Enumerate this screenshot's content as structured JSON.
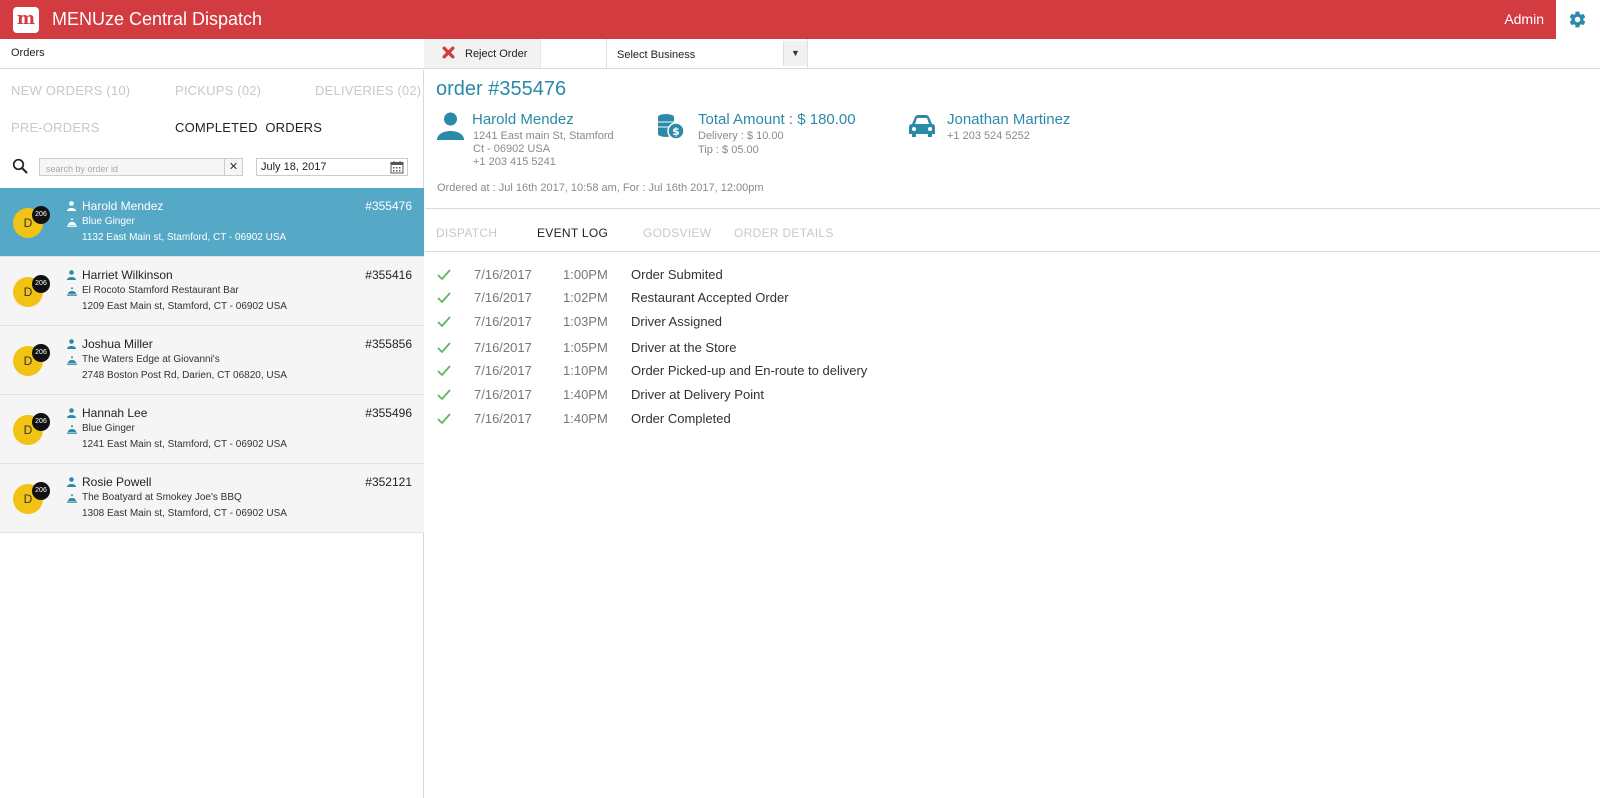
{
  "header": {
    "logo_letter": "m",
    "title": "MENUze Central Dispatch",
    "user": "Admin",
    "settings_icon": "gear-icon"
  },
  "toolbar": {
    "orders_label": "Orders",
    "reject_label": "Reject Order",
    "business_select": "Select Business"
  },
  "filters": {
    "new_orders": "NEW ORDERS (10)",
    "pickups": "PICKUPS (02)",
    "deliveries": "DELIVERIES (02)",
    "pre_orders": "PRE-ORDERS",
    "completed": "COMPLETED",
    "orders": "ORDERS"
  },
  "search": {
    "placeholder": "search by order id",
    "value": "",
    "clear": "✕",
    "date": "July 18, 2017"
  },
  "orders": [
    {
      "initial": "D",
      "badge": "206",
      "customer": "Harold Mendez",
      "restaurant": "Blue Ginger",
      "address": "1132 East Main st, Stamford, CT - 06902 USA",
      "number": "#355476"
    },
    {
      "initial": "D",
      "badge": "206",
      "customer": "Harriet Wilkinson",
      "restaurant": "El Rocoto Stamford Restaurant Bar",
      "address": "1209 East Main st, Stamford, CT - 06902 USA",
      "number": "#355416"
    },
    {
      "initial": "D",
      "badge": "206",
      "customer": "Joshua Miller",
      "restaurant": "The Waters Edge at Giovanni's",
      "address": "2748 Boston Post Rd, Darien, CT 06820, USA",
      "number": "#355856"
    },
    {
      "initial": "D",
      "badge": "206",
      "customer": "Hannah Lee",
      "restaurant": "Blue Ginger",
      "address": "1241 East Main st, Stamford, CT - 06902 USA",
      "number": "#355496"
    },
    {
      "initial": "D",
      "badge": "206",
      "customer": "Rosie Powell",
      "restaurant": "The Boatyard at Smokey Joe's BBQ",
      "address": "1308 East Main st, Stamford, CT - 06902 USA",
      "number": "#352121"
    }
  ],
  "detail": {
    "title": "order #355476",
    "customer": {
      "name": "Harold Mendez",
      "address1": "1241 East main St, Stamford",
      "address2": "Ct - 06902 USA",
      "phone": "+1 203 415 5241"
    },
    "amount": {
      "total": "Total Amount : $ 180.00",
      "delivery": "Delivery : $ 10.00",
      "tip": "Tip : $ 05.00"
    },
    "driver": {
      "name": "Jonathan Martinez",
      "phone": "+1 203 524 5252"
    },
    "ordered_at": "Ordered at : Jul 16th 2017, 10:58 am, For : Jul 16th 2017, 12:00pm"
  },
  "tabs": {
    "dispatch": "DISPATCH",
    "event_log": "EVENT LOG",
    "godsview": "GODSVIEW",
    "order_details": "ORDER DETAILS"
  },
  "events": [
    {
      "date": "7/16/2017",
      "time": "1:00PM",
      "desc": "Order Submited"
    },
    {
      "date": "7/16/2017",
      "time": "1:02PM",
      "desc": "Restaurant Accepted Order"
    },
    {
      "date": "7/16/2017",
      "time": "1:03PM",
      "desc": "Driver Assigned"
    },
    {
      "date": "7/16/2017",
      "time": "1:05PM",
      "desc": "Driver at the Store"
    },
    {
      "date": "7/16/2017",
      "time": "1:10PM",
      "desc": "Order Picked-up and En-route to delivery"
    },
    {
      "date": "7/16/2017",
      "time": "1:40PM",
      "desc": "Driver at Delivery Point"
    },
    {
      "date": "7/16/2017",
      "time": "1:40PM",
      "desc": "Order Completed"
    }
  ],
  "colors": {
    "brand_red": "#d23b3f",
    "accent_teal": "#2a8aa8",
    "selected_row": "#55a9c6",
    "avatar_yellow": "#f2c314",
    "check_green": "#5cb85c"
  }
}
